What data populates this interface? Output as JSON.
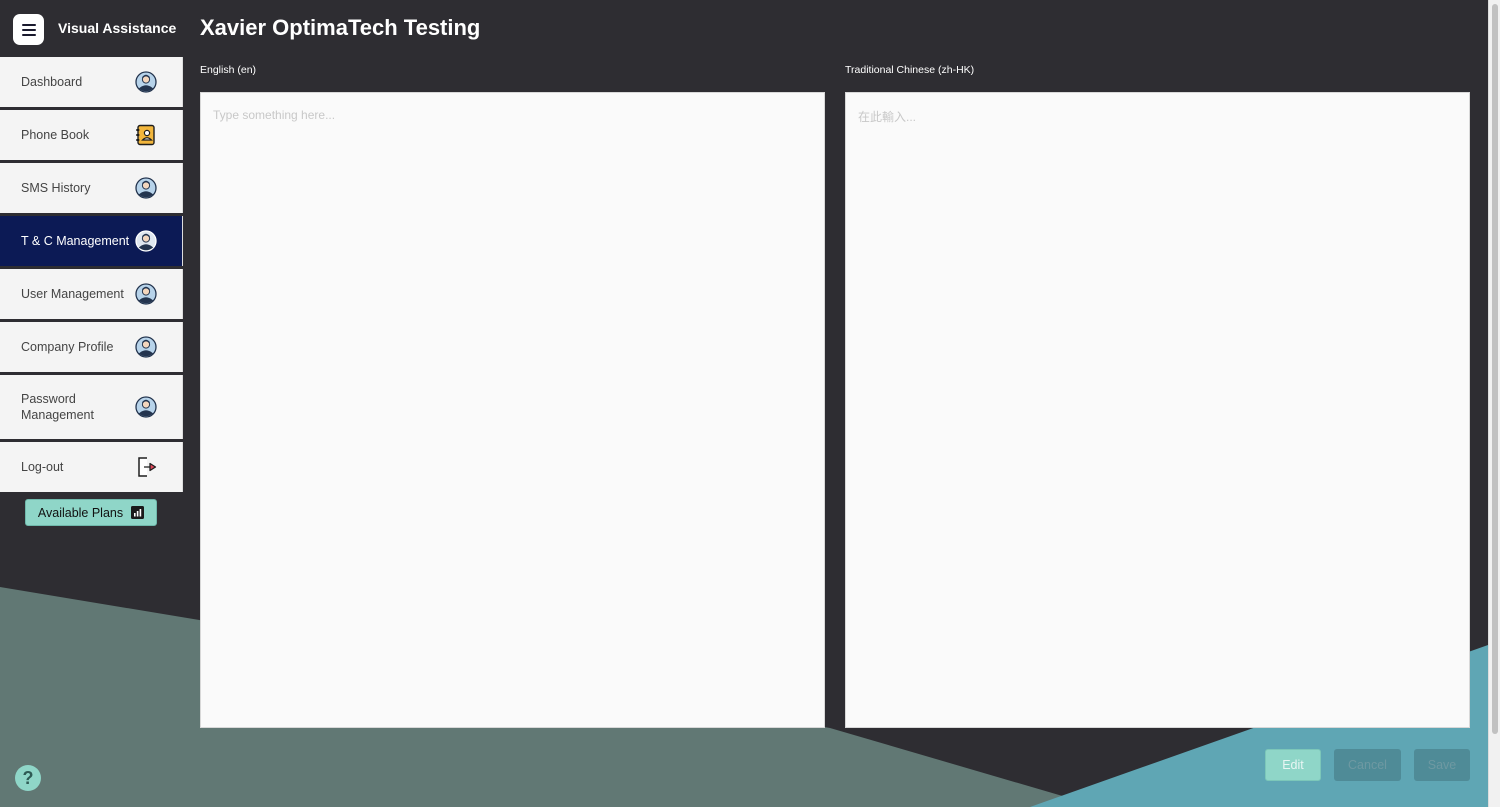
{
  "app": {
    "name": "Visual Assistance"
  },
  "page": {
    "title": "Xavier OptimaTech Testing"
  },
  "sidebar": {
    "items": [
      {
        "label": "Dashboard",
        "icon": "user-avatar-icon",
        "active": false
      },
      {
        "label": "Phone Book",
        "icon": "phonebook-icon",
        "active": false
      },
      {
        "label": "SMS History",
        "icon": "user-avatar-icon",
        "active": false
      },
      {
        "label": "T & C Management",
        "icon": "user-avatar-icon",
        "active": true
      },
      {
        "label": "User Management",
        "icon": "user-avatar-icon",
        "active": false
      },
      {
        "label": "Company Profile",
        "icon": "user-avatar-icon",
        "active": false
      },
      {
        "label": "Password Management",
        "icon": "user-avatar-icon",
        "active": false
      },
      {
        "label": "Log-out",
        "icon": "logout-icon",
        "active": false
      }
    ],
    "plans_label": "Available Plans"
  },
  "editors": {
    "english": {
      "label": "English (en)",
      "value": "",
      "placeholder": "Type something here..."
    },
    "chinese": {
      "label": "Traditional Chinese (zh-HK)",
      "value": "",
      "placeholder": "在此輸入..."
    }
  },
  "actions": {
    "edit": "Edit",
    "cancel": "Cancel",
    "save": "Save"
  },
  "help": {
    "symbol": "?"
  },
  "colors": {
    "background": "#2e2d32",
    "active_nav": "#0c1a55",
    "accent": "#8fd6c8",
    "teal_shape": "#5fa6b4",
    "grey_shape": "#617874"
  }
}
